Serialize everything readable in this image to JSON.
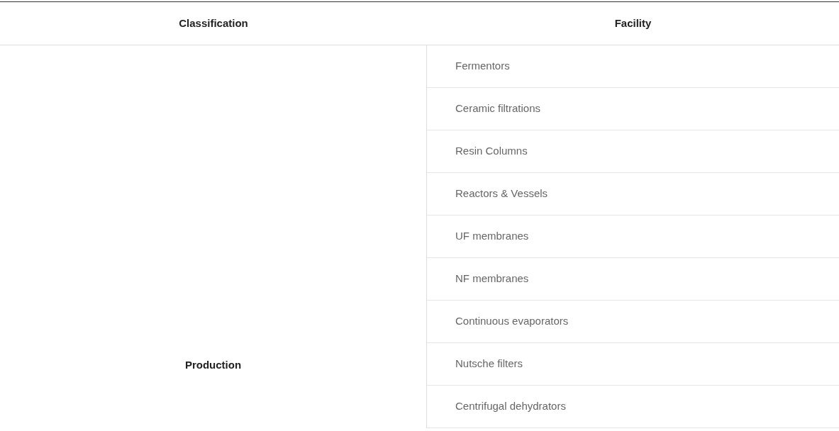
{
  "table": {
    "columns": [
      "Classification",
      "Facility"
    ],
    "rows": [
      {
        "classification": "Production",
        "facilities": [
          "Fermentors",
          "Ceramic filtrations",
          "Resin Columns",
          "Reactors & Vessels",
          "UF membranes",
          "NF membranes",
          "Continuous evaporators",
          "Nutsche filters",
          "Centrifugal dehydrators"
        ]
      }
    ]
  }
}
